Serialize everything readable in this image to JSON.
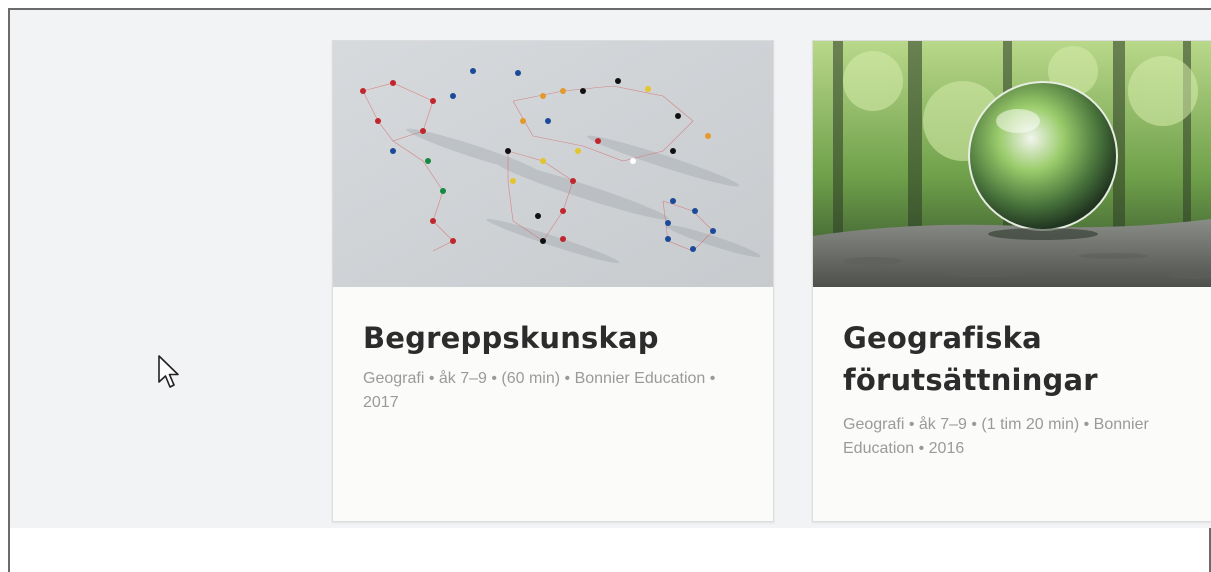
{
  "cards": [
    {
      "title": "Begreppskunskap",
      "meta": "Geografi • åk 7–9 • (60 min) • Bonnier Education • 2017",
      "image_icon": "world-map-pins-image"
    },
    {
      "title": "Geografiska förutsättningar",
      "meta": "Geografi • åk 7–9 • (1 tim 20 min) • Bonnier Education • 2016",
      "image_icon": "glass-globe-forest-image"
    }
  ],
  "colors": {
    "page_background": "#f2f3f5",
    "card_background": "#fbfbfa",
    "title_text": "#2c2c2c",
    "meta_text": "#9a9a9a"
  }
}
